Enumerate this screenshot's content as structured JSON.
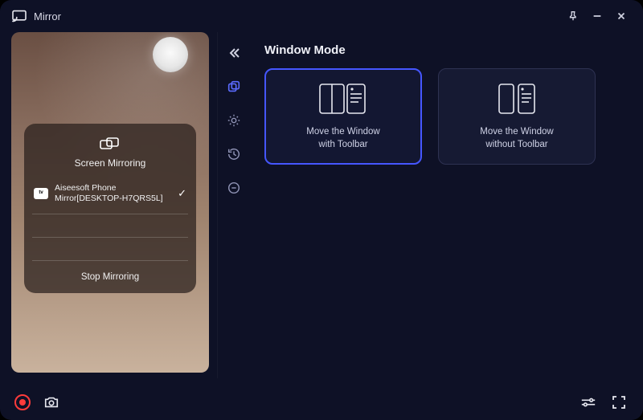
{
  "titlebar": {
    "title": "Mirror"
  },
  "phone": {
    "mirroring": {
      "heading": "Screen Mirroring",
      "device_badge": "tv",
      "device_name": "Aiseesoft Phone Mirror[DESKTOP-H7QRS5L]",
      "stop_label": "Stop Mirroring"
    }
  },
  "panel": {
    "title": "Window Mode",
    "options": [
      {
        "caption": "Move the Window\nwith Toolbar",
        "selected": true,
        "kind": "with-toolbar"
      },
      {
        "caption": "Move the Window\nwithout Toolbar",
        "selected": false,
        "kind": "without-toolbar"
      }
    ]
  }
}
